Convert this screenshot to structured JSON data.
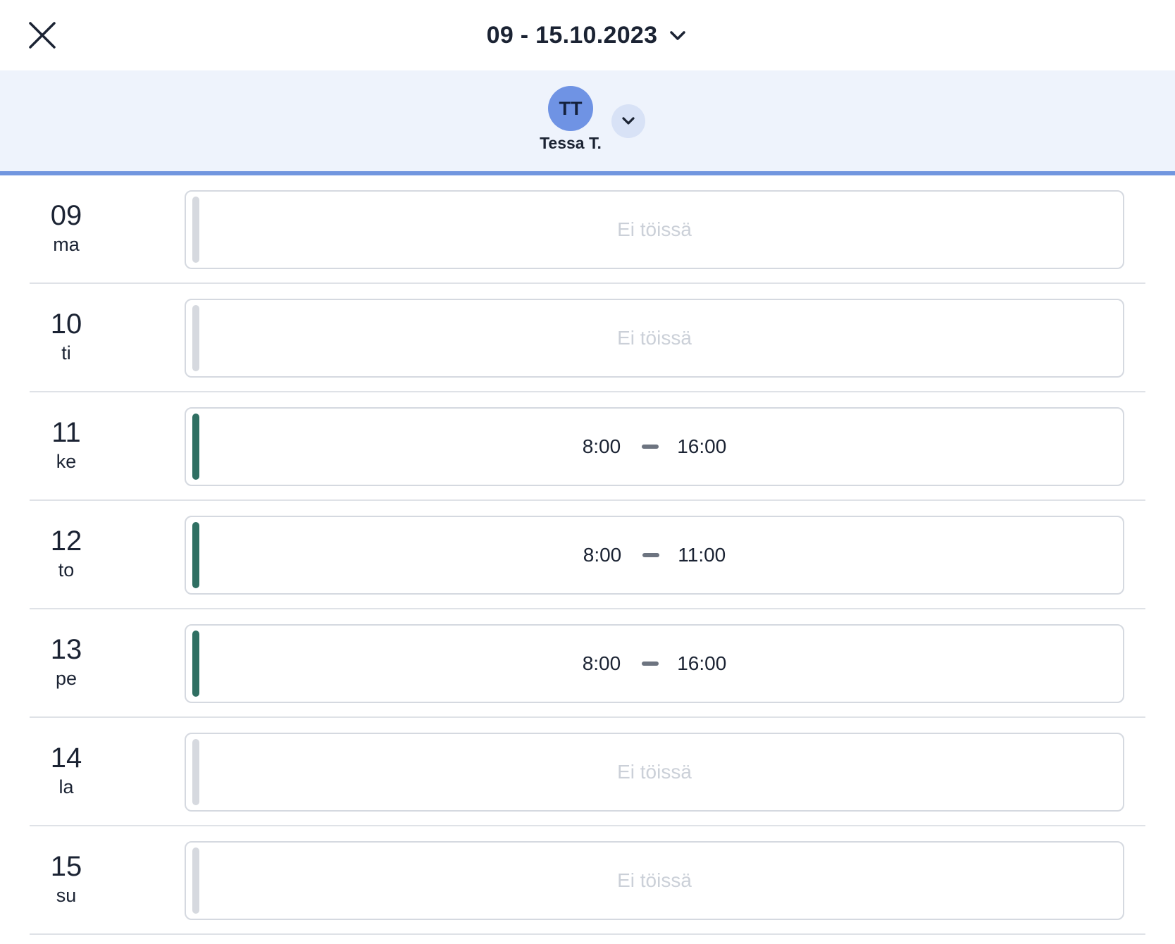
{
  "header": {
    "date_range": "09 - 15.10.2023"
  },
  "person": {
    "initials": "TT",
    "name": "Tessa T."
  },
  "colors": {
    "accent": "#7196df",
    "avatar": "#6f93e4",
    "working_bar": "#2f6f62",
    "off_bar": "#d6d9df",
    "off_text": "#cbd0d8"
  },
  "icons": {
    "close": "close-icon",
    "date_dropdown": "chevron-down-icon",
    "person_dropdown": "chevron-down-icon"
  },
  "days": [
    {
      "num": "09",
      "name": "ma",
      "status": "off",
      "text": "Ei töissä"
    },
    {
      "num": "10",
      "name": "ti",
      "status": "off",
      "text": "Ei töissä"
    },
    {
      "num": "11",
      "name": "ke",
      "status": "work",
      "start": "8:00",
      "end": "16:00"
    },
    {
      "num": "12",
      "name": "to",
      "status": "work",
      "start": "8:00",
      "end": "11:00"
    },
    {
      "num": "13",
      "name": "pe",
      "status": "work",
      "start": "8:00",
      "end": "16:00"
    },
    {
      "num": "14",
      "name": "la",
      "status": "off",
      "text": "Ei töissä"
    },
    {
      "num": "15",
      "name": "su",
      "status": "off",
      "text": "Ei töissä"
    }
  ]
}
